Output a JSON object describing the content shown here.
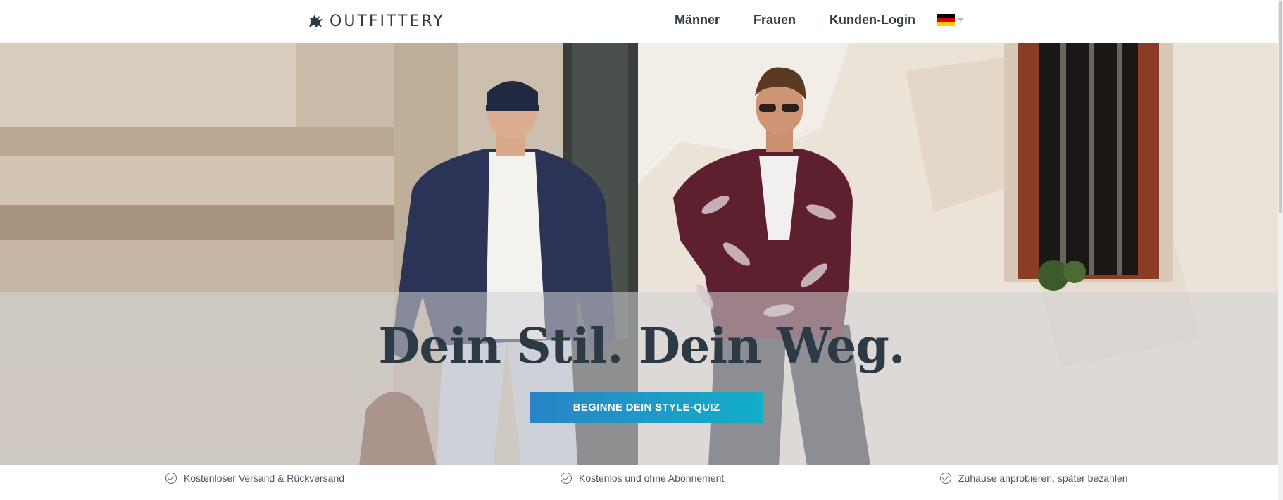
{
  "header": {
    "brand": "OUTFITTERY",
    "nav": [
      {
        "label": "Männer"
      },
      {
        "label": "Frauen"
      },
      {
        "label": "Kunden-Login"
      }
    ],
    "language": {
      "flag": "germany-flag-icon",
      "colors": [
        "#000000",
        "#dd0000",
        "#ffce00"
      ]
    }
  },
  "hero": {
    "headline": "Dein Stil. Dein Weg.",
    "cta_label": "BEGINNE DEIN STYLE-QUIZ",
    "cta_gradient": [
      "#2a84c7",
      "#12aec8"
    ],
    "headline_color": "#2b3a44"
  },
  "usps": [
    {
      "icon": "check-circle-icon",
      "label": "Kostenloser Versand & Rückversand"
    },
    {
      "icon": "check-circle-icon",
      "label": "Kostenlos und ohne Abonnement"
    },
    {
      "icon": "check-circle-icon",
      "label": "Zuhause anprobieren, später bezahlen"
    }
  ]
}
